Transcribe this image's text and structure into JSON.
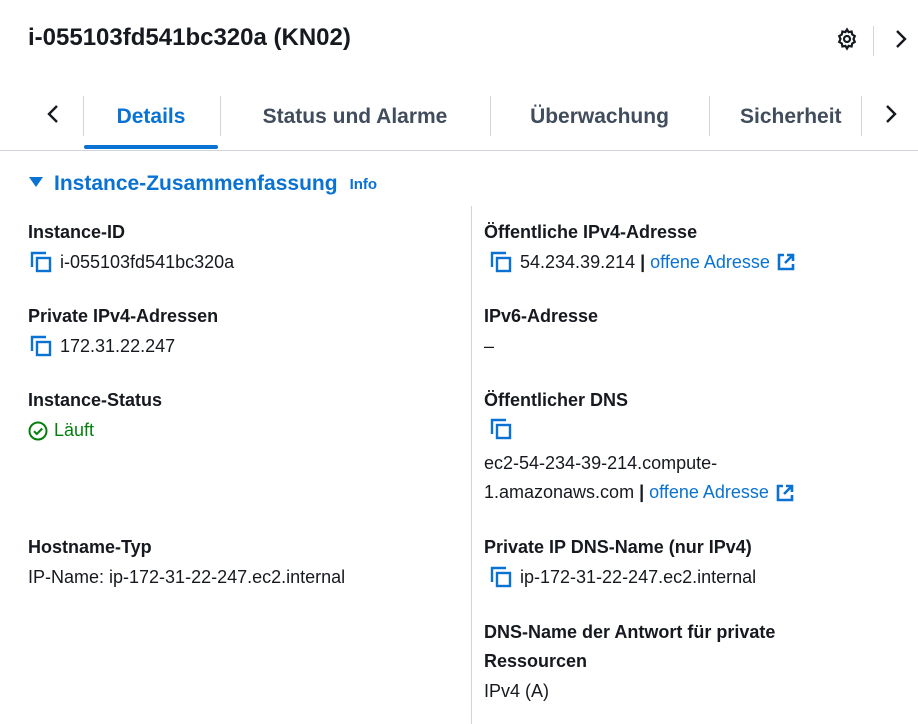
{
  "header": {
    "title": "i-055103fd541bc320a (KN02)",
    "settings_icon": "gear-icon",
    "expand_icon": "chevron-right-icon"
  },
  "tabs": {
    "items": [
      {
        "label": "Details",
        "active": true
      },
      {
        "label": "Status und Alarme",
        "active": false
      },
      {
        "label": "Überwachung",
        "active": false
      },
      {
        "label": "Sicherheit",
        "active": false
      }
    ]
  },
  "section": {
    "title": "Instance-Zusammenfassung",
    "info": "Info"
  },
  "left": {
    "instance_id": {
      "label": "Instance-ID",
      "value": "i-055103fd541bc320a"
    },
    "private_ipv4": {
      "label": "Private IPv4-Adressen",
      "value": "172.31.22.247"
    },
    "instance_status": {
      "label": "Instance-Status",
      "value": "Läuft"
    },
    "hostname_type": {
      "label": "Hostname-Typ",
      "value": "IP-Name: ip-172-31-22-247.ec2.internal"
    }
  },
  "right": {
    "public_ipv4": {
      "label": "Öffentliche IPv4-Adresse",
      "value": "54.234.39.214",
      "separator": "|",
      "link": "offene Adresse"
    },
    "ipv6": {
      "label": "IPv6-Adresse",
      "value": "–"
    },
    "public_dns": {
      "label": "Öffentlicher DNS",
      "value_line1": "ec2-54-234-39-214.compute-",
      "value_line2": "1.amazonaws.com",
      "separator": "|",
      "link": "offene Adresse"
    },
    "private_ip_dns": {
      "label": "Private IP DNS-Name (nur IPv4)",
      "value": "ip-172-31-22-247.ec2.internal"
    },
    "dns_answer": {
      "label_line1": "DNS-Name der Antwort für private",
      "label_line2": "Ressourcen",
      "value": "IPv4 (A)"
    }
  },
  "colors": {
    "accent": "#0972d3",
    "success": "#037f0c",
    "text": "#16191f",
    "divider": "#d1d5db"
  }
}
